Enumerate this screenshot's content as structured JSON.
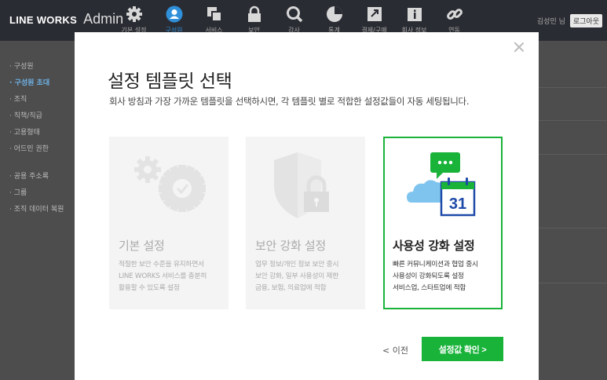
{
  "header": {
    "brand": "LINE WORKS",
    "product": "Admin",
    "nav": [
      {
        "icon": "gear-icon",
        "label": "기본 설정"
      },
      {
        "icon": "user-icon",
        "label": "구성원",
        "active": true
      },
      {
        "icon": "copy-icon",
        "label": "서비스"
      },
      {
        "icon": "lock-icon",
        "label": "보안"
      },
      {
        "icon": "search-icon",
        "label": "감사"
      },
      {
        "icon": "chart-icon",
        "label": "통계"
      },
      {
        "icon": "upload-icon",
        "label": "결제/구매"
      },
      {
        "icon": "info-icon",
        "label": "회사 정보"
      },
      {
        "icon": "link-icon",
        "label": "연동"
      }
    ],
    "user_name": "김성민 님",
    "logout_label": "로그아웃"
  },
  "sidebar": {
    "group1": [
      "구성원",
      "구성원 초대",
      "조직",
      "직책/직급",
      "고용형태",
      "어드민 권한"
    ],
    "active_index": 1,
    "group2": [
      "공용 주소록",
      "그룹",
      "조직 데이터 복원"
    ]
  },
  "modal": {
    "title": "설정 템플릿 선택",
    "subtitle": "회사 방침과 가장 가까운 템플릿을 선택하시면, 각 템플릿 별로 적합한 설정값들이 자동 세팅됩니다.",
    "cards": [
      {
        "title": "기본 설정",
        "desc": [
          "적절한 보안 수준을 유지하면서",
          "LINE WORKS 서비스를 충분히",
          "활용할 수 있도록 설정"
        ],
        "selected": false
      },
      {
        "title": "보안 강화 설정",
        "desc": [
          "업무 정보/개인 정보 보안 중시",
          "보안 강화, 일부 사용성이 제한",
          "금융, 보험, 의료업에 적합"
        ],
        "selected": false
      },
      {
        "title": "사용성 강화 설정",
        "desc": [
          "빠른 커뮤니케이션과 협업 중시",
          "사용성이 강화되도록 설정",
          "서비스업, 스타트업에 적합"
        ],
        "selected": true,
        "calendar_number": "31"
      }
    ],
    "prev_label": "< 이전",
    "confirm_label": "설정값 확인 >"
  },
  "colors": {
    "accent": "#19b33a",
    "topbar": "#2a2c33",
    "sidebar_active": "#6fb3e8"
  }
}
